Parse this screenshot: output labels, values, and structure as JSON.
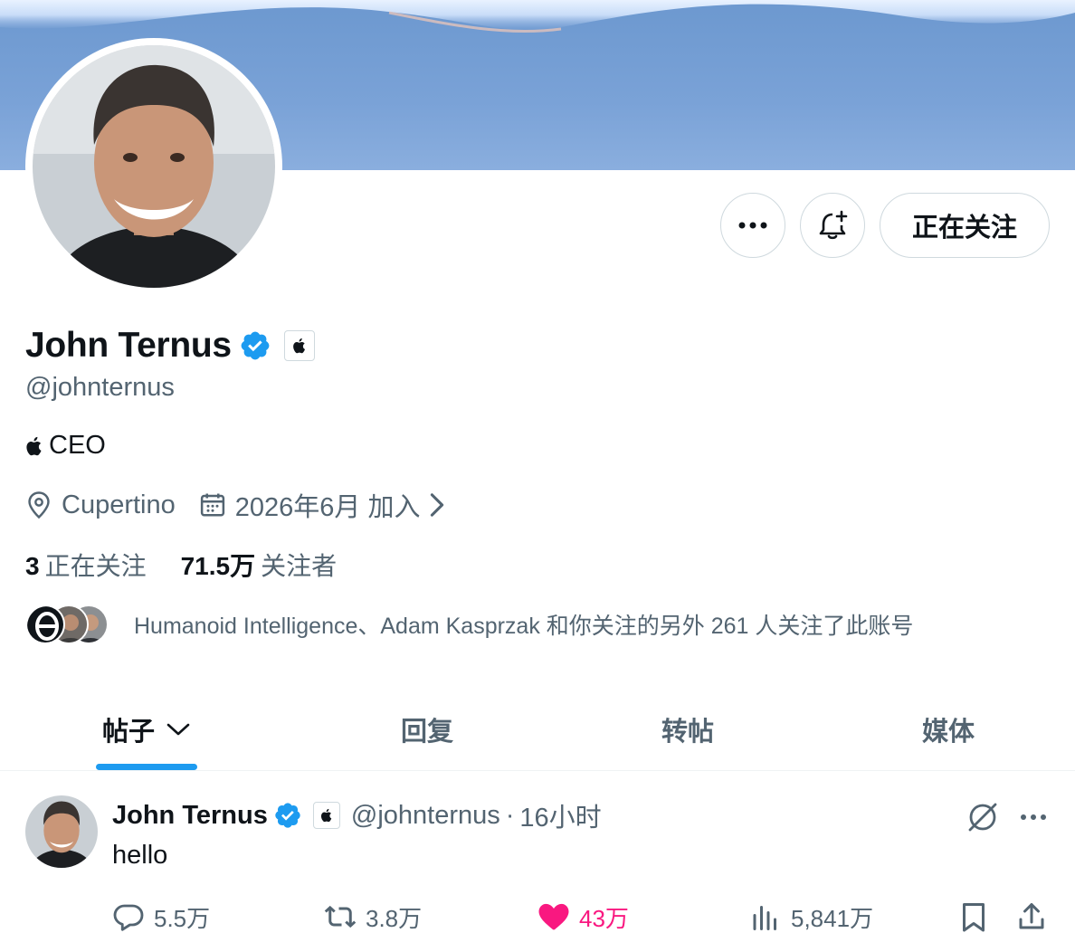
{
  "profile": {
    "name": "John Ternus",
    "handle": "@johnternus",
    "bio": "CEO",
    "location": "Cupertino",
    "joined": "2026年6月 加入"
  },
  "actions": {
    "follow_label": "正在关注",
    "more_icon": "more-icon",
    "notify_icon": "bell-plus-icon"
  },
  "stats": {
    "following_count": "3",
    "following_label": "正在关注",
    "followers_count": "71.5万",
    "followers_label": "关注者"
  },
  "followers_you_know": "Humanoid Intelligence、Adam Kasprzak 和你关注的另外 261 人关注了此账号",
  "tabs": [
    {
      "label": "帖子",
      "active": true
    },
    {
      "label": "回复",
      "active": false
    },
    {
      "label": "转帖",
      "active": false
    },
    {
      "label": "媒体",
      "active": false
    }
  ],
  "post": {
    "name": "John Ternus",
    "handle": "@johnternus",
    "separator": "·",
    "time": "16小时",
    "text": "hello",
    "replies": "5.5万",
    "reposts": "3.8万",
    "likes": "43万",
    "views": "5,841万"
  },
  "colors": {
    "accent": "#1d9bf0",
    "like": "#f91880",
    "secondary_text": "#536471",
    "border": "#cfd9de"
  }
}
